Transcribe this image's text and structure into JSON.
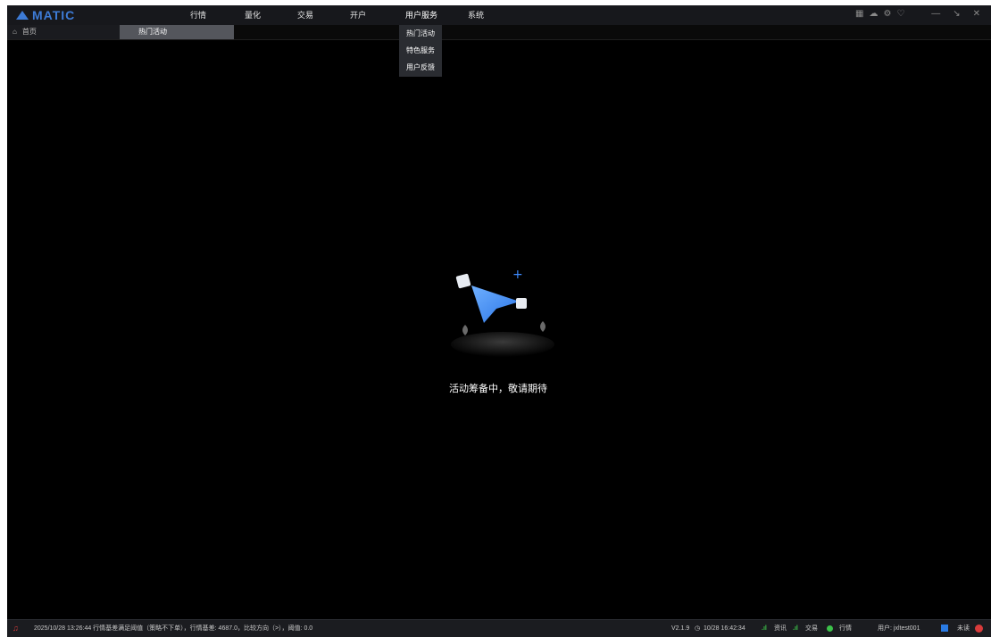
{
  "app": {
    "logo_text": "MATIC",
    "brand_color": "#3d7bd6"
  },
  "menu": [
    {
      "label": "行情"
    },
    {
      "label": "量化"
    },
    {
      "label": "交易"
    },
    {
      "label": "开户"
    },
    {
      "label": "用户服务"
    },
    {
      "label": "系统"
    }
  ],
  "dropdown": {
    "items": [
      "热门活动",
      "特色服务",
      "用户反馈"
    ]
  },
  "tabs": {
    "home": "首页",
    "active": "热门活动"
  },
  "empty_state": {
    "message": "活动筹备中，敬请期待"
  },
  "status": {
    "message": "2025/10/28 13:26:44 行情基差满足阈值（策略不下单），行情基差: 4687.0，比较方向（>），阈值: 0.0",
    "version": "V2.1.9",
    "time": "10/28 16:42:34",
    "news": "资讯",
    "trade": "交易",
    "quote": "行情",
    "user": "用户: jxltest001",
    "read": "未读"
  },
  "icons": {
    "top_right": [
      "grid-icon",
      "cloud-icon",
      "settings-icon",
      "shield-icon"
    ],
    "window": [
      "minimize-icon",
      "restore-icon",
      "close-icon"
    ]
  }
}
